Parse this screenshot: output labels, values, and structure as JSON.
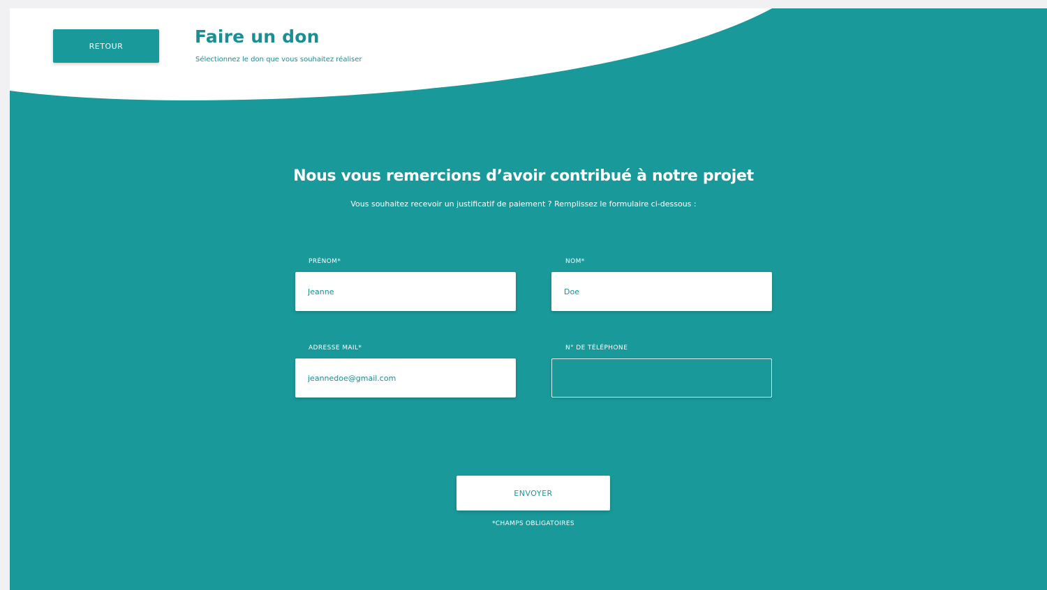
{
  "header": {
    "back_label": "RETOUR",
    "title": "Faire un don",
    "subtitle": "Sélectionnez le don que vous souhaitez réaliser"
  },
  "main": {
    "heading": "Nous vous remercions d’avoir contribué à notre projet",
    "subheading": "Vous souhaitez recevoir un justificatif de paiement ? Remplissez le formulaire ci-dessous :"
  },
  "form": {
    "first_name": {
      "label": "PRÉNOM*",
      "value": "Jeanne"
    },
    "last_name": {
      "label": "NOM*",
      "value": "Doe"
    },
    "email": {
      "label": "ADRESSE MAIL*",
      "value": "jeannedoe@gmail.com"
    },
    "phone": {
      "label": "N° DE TÉLÉPHONE",
      "value": ""
    },
    "submit_label": "ENVOYER",
    "required_note": "*CHAMPS OBLIGATOIRES"
  },
  "colors": {
    "primary": "#1a999b",
    "text_accent": "#1a8f92",
    "surface": "#ffffff"
  }
}
